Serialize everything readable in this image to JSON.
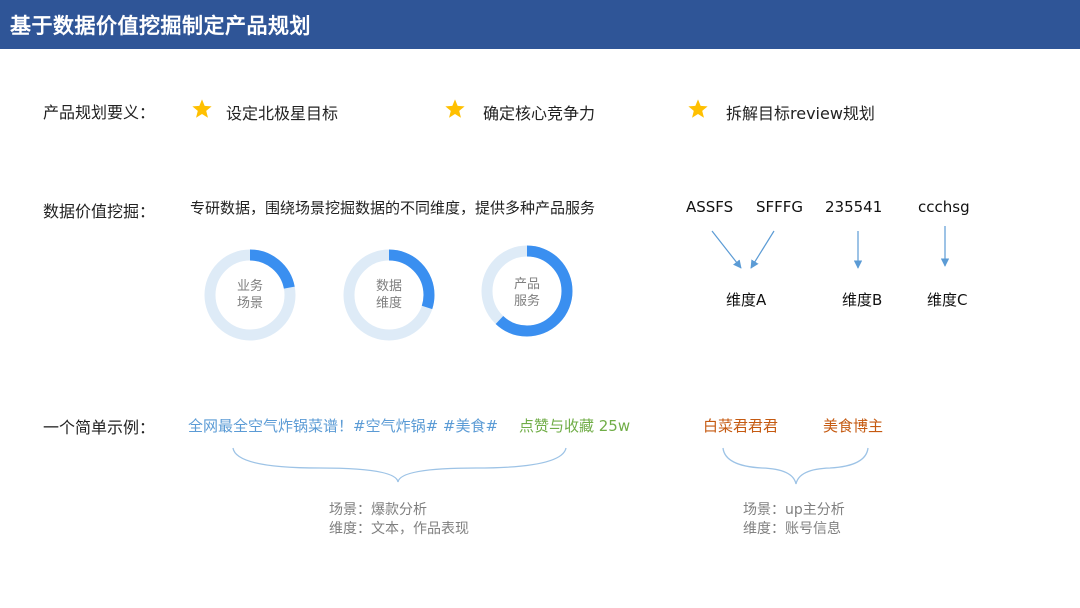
{
  "header": {
    "title": "基于数据价值挖掘制定产品规划"
  },
  "planning": {
    "label": "产品规划要义：",
    "goals": [
      {
        "text": "设定北极星目标",
        "icon": "star-icon"
      },
      {
        "text": "确定核心竞争力",
        "icon": "star-icon"
      },
      {
        "text": "拆解目标review规划",
        "icon": "star-icon"
      }
    ]
  },
  "mining": {
    "label": "数据价值挖掘：",
    "description": "专研数据，围绕场景挖掘数据的不同维度，提供多种产品服务",
    "donuts": [
      {
        "line1": "业务",
        "line2": "场景",
        "fill": 0.22
      },
      {
        "line1": "数据",
        "line2": "维度",
        "fill": 0.3
      },
      {
        "line1": "产品",
        "line2": "服务",
        "fill": 0.62
      }
    ],
    "codes": [
      "ASSFS",
      "SFFFG",
      "235541",
      "ccchsg"
    ],
    "dimensions": [
      "维度A",
      "维度B",
      "维度C"
    ]
  },
  "example": {
    "label": "一个简单示例：",
    "title_text": "全网最全空气炸锅菜谱！#空气炸锅# #美食#",
    "stats_text": "点赞与收藏 25w",
    "author_name": "白菜君君君",
    "author_tag": "美食博主",
    "note_left": {
      "line1": "场景：爆款分析",
      "line2": "维度：文本，作品表现"
    },
    "note_right": {
      "line1": "场景：up主分析",
      "line2": "维度：账号信息"
    }
  },
  "colors": {
    "header": "#2f5597",
    "star": "#ffc000",
    "donut_fill": "#3a8ff0",
    "donut_track": "#deebf7",
    "arrow": "#5b9bd5",
    "brace": "#9dc3e6",
    "example_blue": "#5b9bd5",
    "example_green": "#70ad47",
    "example_orange": "#c55a11"
  }
}
